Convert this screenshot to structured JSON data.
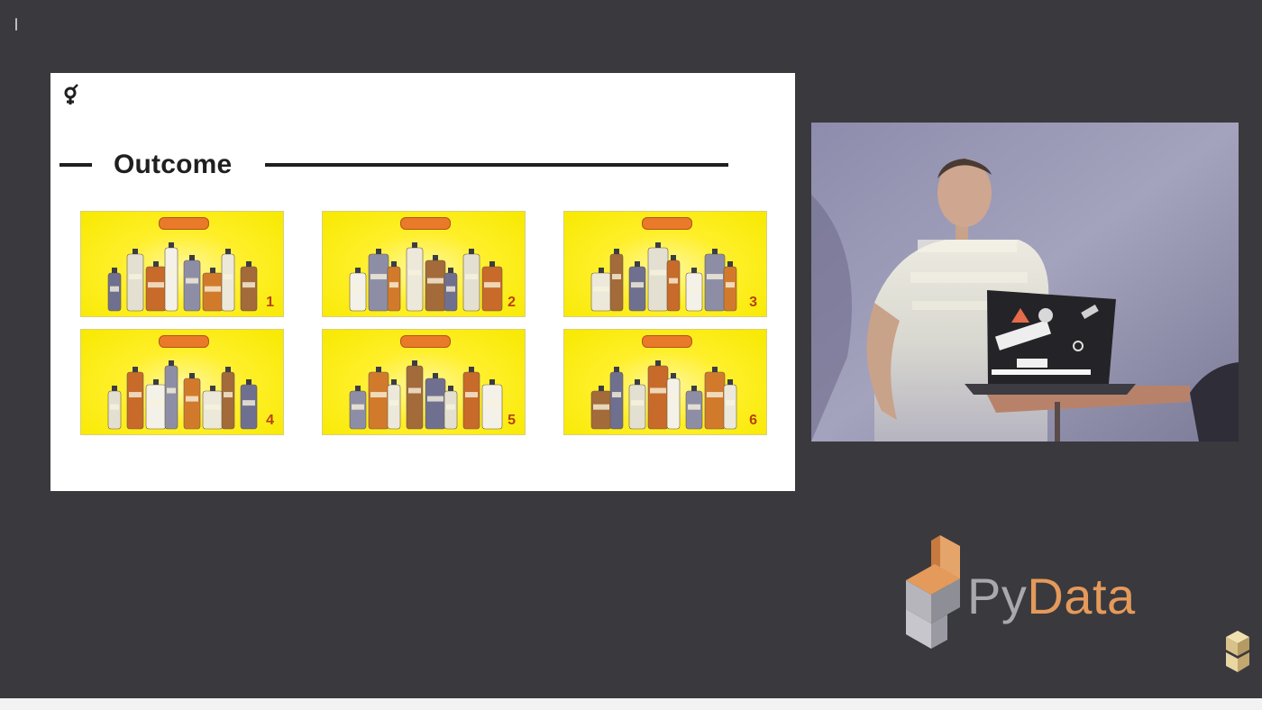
{
  "slide": {
    "title": "Outcome",
    "tiles": [
      {
        "number": "1"
      },
      {
        "number": "2"
      },
      {
        "number": "3"
      },
      {
        "number": "4"
      },
      {
        "number": "5"
      },
      {
        "number": "6"
      }
    ]
  },
  "brand": {
    "py": "Py",
    "data": "Data"
  },
  "colors": {
    "background": "#3a393e",
    "slide": "#ffffff",
    "tile_yellow": "#f7e900",
    "tile_number": "#b8410d",
    "pydata_gray": "#a8a8ad",
    "pydata_orange": "#e49a5a"
  },
  "icons": {
    "slide_logo": "gender-symbol-logo",
    "brand_logo": "pydata-cube-chair-logo",
    "corner_logo": "pydata-stacked-cubes-logo"
  }
}
